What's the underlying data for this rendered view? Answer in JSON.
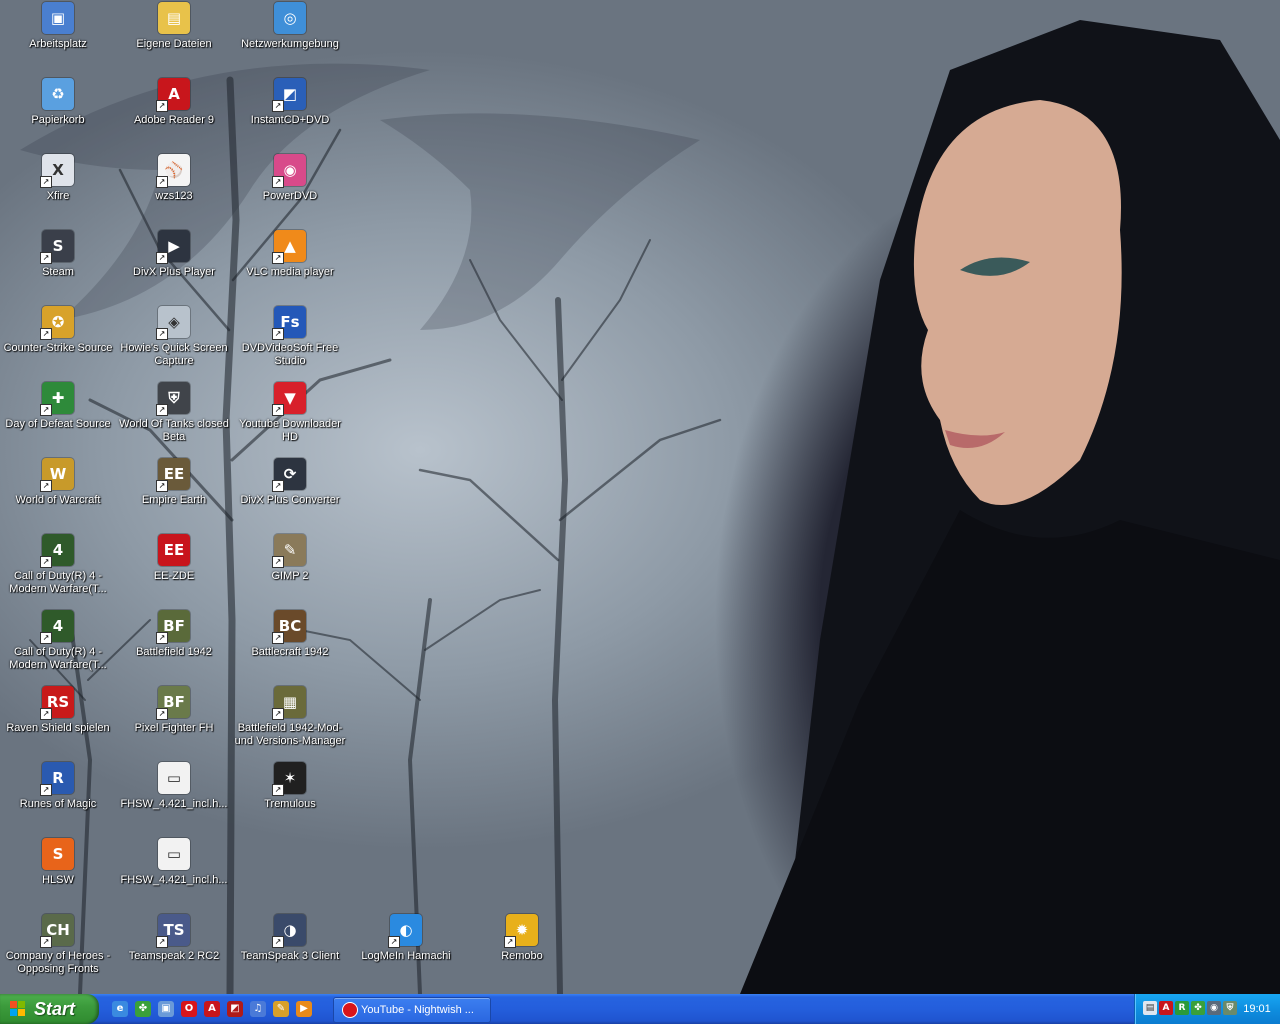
{
  "desktop": {
    "icons": [
      {
        "label": "Arbeitsplatz",
        "icon": "computer-icon",
        "color": "#4a7fd0",
        "sym": "▣",
        "shortcut": false
      },
      {
        "label": "Eigene Dateien",
        "icon": "folder-icon",
        "color": "#e8c24a",
        "sym": "▤",
        "shortcut": false
      },
      {
        "label": "Netzwerkumgebung",
        "icon": "network-icon",
        "color": "#3f8fd8",
        "sym": "◎",
        "shortcut": false
      },
      {
        "label": "Papierkorb",
        "icon": "recycle-bin-icon",
        "color": "#5aa0e0",
        "sym": "♻",
        "shortcut": false
      },
      {
        "label": "Adobe Reader 9",
        "icon": "adobe-reader-icon",
        "color": "#c8161c",
        "sym": "A",
        "shortcut": true
      },
      {
        "label": "InstantCD+DVD",
        "icon": "instantcd-icon",
        "color": "#2a5fb8",
        "sym": "◩",
        "shortcut": true
      },
      {
        "label": "Xfire",
        "icon": "xfire-icon",
        "color": "#dfe3ea",
        "sym": "X",
        "shortcut": true
      },
      {
        "label": "wzs123",
        "icon": "baseball-icon",
        "color": "#f4f4f4",
        "sym": "⚾",
        "shortcut": true
      },
      {
        "label": "PowerDVD",
        "icon": "powerdvd-icon",
        "color": "#d84a8a",
        "sym": "◉",
        "shortcut": true
      },
      {
        "label": "Steam",
        "icon": "steam-icon",
        "color": "#3a3f4a",
        "sym": "S",
        "shortcut": true
      },
      {
        "label": "DivX Plus Player",
        "icon": "divx-player-icon",
        "color": "#2d3440",
        "sym": "▶",
        "shortcut": true
      },
      {
        "label": "VLC media player",
        "icon": "vlc-icon",
        "color": "#f08a1a",
        "sym": "▲",
        "shortcut": true
      },
      {
        "label": "Counter-Strike Source",
        "icon": "counter-strike-icon",
        "color": "#d8a22a",
        "sym": "✪",
        "shortcut": true
      },
      {
        "label": "Howie's Quick Screen Capture",
        "icon": "screen-capture-icon",
        "color": "#b8c2cc",
        "sym": "◈",
        "shortcut": true
      },
      {
        "label": "DVDVideoSoft Free Studio",
        "icon": "dvdvideosoft-icon",
        "color": "#2458b8",
        "sym": "Fs",
        "shortcut": true
      },
      {
        "label": "Day of Defeat Source",
        "icon": "day-of-defeat-icon",
        "color": "#2e8a3a",
        "sym": "✚",
        "shortcut": true
      },
      {
        "label": "World Of Tanks closed Beta",
        "icon": "world-of-tanks-icon",
        "color": "#40444a",
        "sym": "⛨",
        "shortcut": true
      },
      {
        "label": "Youtube Downloader HD",
        "icon": "youtube-downloader-icon",
        "color": "#d8202a",
        "sym": "▼",
        "shortcut": true
      },
      {
        "label": "World of Warcraft",
        "icon": "world-of-warcraft-icon",
        "color": "#c89a2a",
        "sym": "W",
        "shortcut": true
      },
      {
        "label": "Empire Earth",
        "icon": "empire-earth-icon",
        "color": "#6a5a3a",
        "sym": "EE",
        "shortcut": true
      },
      {
        "label": "DivX Plus Converter",
        "icon": "divx-converter-icon",
        "color": "#2d3440",
        "sym": "⟳",
        "shortcut": true
      },
      {
        "label": "Call of Duty(R) 4 - Modern Warfare(T...",
        "icon": "call-of-duty-icon",
        "color": "#2f5a2a",
        "sym": "4",
        "shortcut": true
      },
      {
        "label": "EE-ZDE",
        "icon": "ee-zde-icon",
        "color": "#c8141c",
        "sym": "EE",
        "shortcut": false
      },
      {
        "label": "GIMP 2",
        "icon": "gimp-icon",
        "color": "#8a7a5a",
        "sym": "✎",
        "shortcut": true
      },
      {
        "label": "Call of Duty(R) 4 - Modern Warfare(T...",
        "icon": "call-of-duty-icon",
        "color": "#2f5a2a",
        "sym": "4",
        "shortcut": true
      },
      {
        "label": "Battlefield 1942",
        "icon": "battlefield-icon",
        "color": "#5a6a3a",
        "sym": "BF",
        "shortcut": true
      },
      {
        "label": "Battlecraft 1942",
        "icon": "battlecraft-icon",
        "color": "#6a4a2a",
        "sym": "BC",
        "shortcut": true
      },
      {
        "label": "Raven Shield spielen",
        "icon": "raven-shield-icon",
        "color": "#c81a1a",
        "sym": "RS",
        "shortcut": true
      },
      {
        "label": "Pixel Fighter FH",
        "icon": "pixel-fighter-icon",
        "color": "#6a7a4a",
        "sym": "BF",
        "shortcut": true
      },
      {
        "label": "Battlefield 1942-Mod- und Versions-Manager",
        "icon": "battlefield-manager-icon",
        "color": "#6a6a3a",
        "sym": "▦",
        "shortcut": true
      },
      {
        "label": "Runes of Magic",
        "icon": "runes-of-magic-icon",
        "color": "#2a5ab0",
        "sym": "R",
        "shortcut": true
      },
      {
        "label": "FHSW_4.421_incl.h...",
        "icon": "window-file-icon",
        "color": "#f2f2f2",
        "sym": "▭",
        "shortcut": false
      },
      {
        "label": "Tremulous",
        "icon": "tremulous-icon",
        "color": "#202020",
        "sym": "✶",
        "shortcut": true
      },
      {
        "label": "HLSW",
        "icon": "hlsw-icon",
        "color": "#e8641a",
        "sym": "S",
        "shortcut": false
      },
      {
        "label": "FHSW_4.421_incl.h...",
        "icon": "window-file-icon",
        "color": "#f2f2f2",
        "sym": "▭",
        "shortcut": false
      },
      {
        "label": "Company of Heroes - Opposing Fronts",
        "icon": "company-of-heroes-icon",
        "color": "#5a6a4a",
        "sym": "CH",
        "shortcut": true
      },
      {
        "label": "Teamspeak 2 RC2",
        "icon": "teamspeak2-icon",
        "color": "#4a5a8a",
        "sym": "TS",
        "shortcut": true
      },
      {
        "label": "TeamSpeak 3 Client",
        "icon": "teamspeak3-icon",
        "color": "#3a4a6a",
        "sym": "◑",
        "shortcut": true
      },
      {
        "label": "LogMeIn Hamachi",
        "icon": "hamachi-icon",
        "color": "#2a8ae0",
        "sym": "◐",
        "shortcut": true
      },
      {
        "label": "Remobo",
        "icon": "remobo-icon",
        "color": "#e8b01a",
        "sym": "✹",
        "shortcut": true
      }
    ]
  },
  "taskbar": {
    "start_label": "Start",
    "quick_launch": [
      {
        "icon": "ie-icon",
        "color": "#3a8ae0",
        "sym": "e"
      },
      {
        "icon": "clover-icon",
        "color": "#3aa03a",
        "sym": "✤"
      },
      {
        "icon": "desktop-icon",
        "color": "#6a9ad8",
        "sym": "▣"
      },
      {
        "icon": "opera-icon",
        "color": "#d8151b",
        "sym": "O"
      },
      {
        "icon": "adobe-icon",
        "color": "#c8161c",
        "sym": "A"
      },
      {
        "icon": "instantcd-icon",
        "color": "#b01a1a",
        "sym": "◩"
      },
      {
        "icon": "music-icon",
        "color": "#4a7ad8",
        "sym": "♫"
      },
      {
        "icon": "pencil-icon",
        "color": "#d8a02a",
        "sym": "✎"
      },
      {
        "icon": "media-player-icon",
        "color": "#e88a1a",
        "sym": "▶"
      }
    ],
    "tasks": [
      {
        "label": "YouTube - Nightwish ...",
        "icon": "opera-icon"
      }
    ],
    "tray": {
      "icons": [
        {
          "icon": "network-tray-icon",
          "color": "#dfe6ef",
          "sym": "▤"
        },
        {
          "icon": "adobe-tray-icon",
          "color": "#c8161c",
          "sym": "A"
        },
        {
          "icon": "r-tray-icon",
          "color": "#2a9a3a",
          "sym": "R"
        },
        {
          "icon": "green-tray-icon",
          "color": "#3aa03a",
          "sym": "✤"
        },
        {
          "icon": "speaker-tray-icon",
          "color": "#5a6a7a",
          "sym": "◉"
        },
        {
          "icon": "security-tray-icon",
          "color": "#6a8a6a",
          "sym": "⛨"
        }
      ],
      "clock": "19:01"
    }
  }
}
